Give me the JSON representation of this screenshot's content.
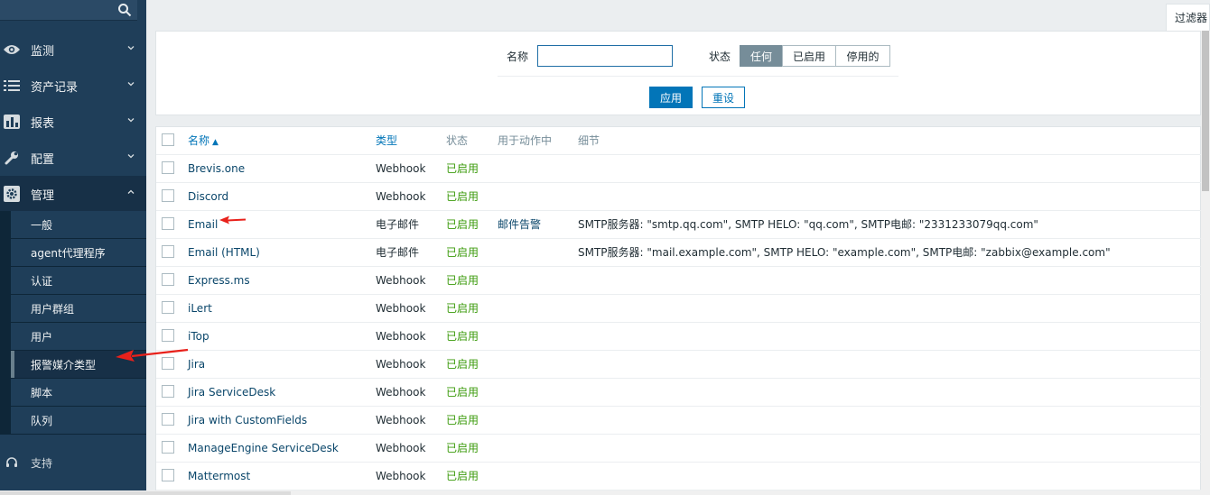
{
  "sidebar": {
    "nav": [
      {
        "label": "监测",
        "icon": "eye-icon"
      },
      {
        "label": "资产记录",
        "icon": "list-icon"
      },
      {
        "label": "报表",
        "icon": "bar-chart-icon"
      },
      {
        "label": "配置",
        "icon": "wrench-icon"
      },
      {
        "label": "管理",
        "icon": "gear-icon"
      }
    ],
    "admin_submenu": [
      "一般",
      "agent代理程序",
      "认证",
      "用户群组",
      "用户",
      "报警媒介类型",
      "脚本",
      "队列"
    ],
    "selected_submenu": "报警媒介类型",
    "support_label": "支持"
  },
  "filter": {
    "tab_label": "过滤器",
    "name_label": "名称",
    "name_value": "",
    "status_label": "状态",
    "status_options": [
      "任何",
      "已启用",
      "停用的"
    ],
    "status_selected": "任何",
    "apply_label": "应用",
    "reset_label": "重设"
  },
  "table": {
    "headers": {
      "name": "名称",
      "type": "类型",
      "status": "状态",
      "used_in_actions": "用于动作中",
      "details": "细节"
    },
    "sort_indicator": "▲",
    "rows": [
      {
        "name": "Brevis.one",
        "type": "Webhook",
        "status": "已启用",
        "action": "",
        "details": ""
      },
      {
        "name": "Discord",
        "type": "Webhook",
        "status": "已启用",
        "action": "",
        "details": ""
      },
      {
        "name": "Email",
        "type": "电子邮件",
        "status": "已启用",
        "action": "邮件告警",
        "details": "SMTP服务器: \"smtp.qq.com\", SMTP HELO: \"qq.com\", SMTP电邮: \"2331233079qq.com\""
      },
      {
        "name": "Email (HTML)",
        "type": "电子邮件",
        "status": "已启用",
        "action": "",
        "details": "SMTP服务器: \"mail.example.com\", SMTP HELO: \"example.com\", SMTP电邮: \"zabbix@example.com\""
      },
      {
        "name": "Express.ms",
        "type": "Webhook",
        "status": "已启用",
        "action": "",
        "details": ""
      },
      {
        "name": "iLert",
        "type": "Webhook",
        "status": "已启用",
        "action": "",
        "details": ""
      },
      {
        "name": "iTop",
        "type": "Webhook",
        "status": "已启用",
        "action": "",
        "details": ""
      },
      {
        "name": "Jira",
        "type": "Webhook",
        "status": "已启用",
        "action": "",
        "details": ""
      },
      {
        "name": "Jira ServiceDesk",
        "type": "Webhook",
        "status": "已启用",
        "action": "",
        "details": ""
      },
      {
        "name": "Jira with CustomFields",
        "type": "Webhook",
        "status": "已启用",
        "action": "",
        "details": ""
      },
      {
        "name": "ManageEngine ServiceDesk",
        "type": "Webhook",
        "status": "已启用",
        "action": "",
        "details": ""
      },
      {
        "name": "Mattermost",
        "type": "Webhook",
        "status": "已启用",
        "action": "",
        "details": ""
      }
    ]
  },
  "colors": {
    "sidebar_bg": "#1f3e59",
    "link": "#0a466a",
    "enabled_green": "#3a9a0a",
    "primary_button": "#0275b8",
    "annotation_arrow": "#e8211b"
  }
}
